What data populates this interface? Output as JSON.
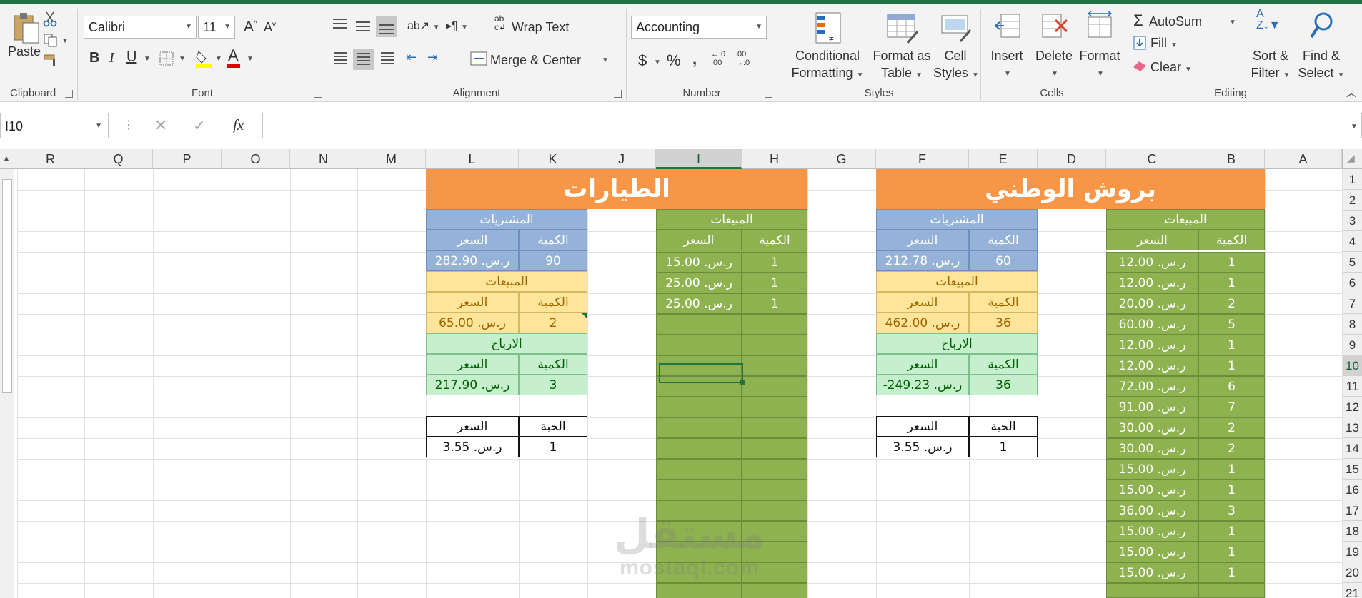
{
  "ribbon": {
    "clipboard": {
      "label": "Clipboard",
      "paste": "Paste"
    },
    "font": {
      "label": "Font",
      "font_name": "Calibri",
      "font_size": "11"
    },
    "alignment": {
      "label": "Alignment",
      "wrap_text": "Wrap Text",
      "merge_center": "Merge & Center"
    },
    "number": {
      "label": "Number",
      "format": "Accounting"
    },
    "styles": {
      "label": "Styles",
      "conditional": [
        "Conditional",
        "Formatting"
      ],
      "format_table": [
        "Format as",
        "Table"
      ],
      "cell_styles": [
        "Cell",
        "Styles"
      ]
    },
    "cells": {
      "label": "Cells",
      "insert": "Insert",
      "delete": "Delete",
      "format": "Format"
    },
    "editing": {
      "label": "Editing",
      "autosum": "AutoSum",
      "fill": "Fill",
      "clear": "Clear",
      "sort": [
        "Sort &",
        "Filter"
      ],
      "find": [
        "Find &",
        "Select"
      ]
    }
  },
  "formula_bar": {
    "name_box": "I10",
    "fx": "fx",
    "formula": ""
  },
  "columns": [
    "R",
    "Q",
    "P",
    "O",
    "N",
    "M",
    "L",
    "K",
    "J",
    "I",
    "H",
    "G",
    "F",
    "E",
    "D",
    "C",
    "B",
    "A"
  ],
  "rows": [
    "1",
    "2",
    "3",
    "4",
    "5",
    "6",
    "7",
    "8",
    "9",
    "10",
    "11",
    "12",
    "13",
    "14",
    "15",
    "16",
    "17",
    "18",
    "19",
    "20",
    "21"
  ],
  "selected_cell": "I10",
  "sheet": {
    "right_title": "بروش الوطني",
    "left_title": "الطيارات",
    "sales_header": "المبيعات",
    "purchases_header": "المشتريات",
    "profits_header": "الارباح",
    "qty_header": "الكمية",
    "price_header": "السعر",
    "unit_header": "الحبة",
    "right_sales": [
      {
        "qty": "1",
        "price": "ر.س. 12.00"
      },
      {
        "qty": "1",
        "price": "ر.س. 12.00"
      },
      {
        "qty": "2",
        "price": "ر.س. 20.00"
      },
      {
        "qty": "5",
        "price": "ر.س. 60.00"
      },
      {
        "qty": "1",
        "price": "ر.س. 12.00"
      },
      {
        "qty": "1",
        "price": "ر.س. 12.00"
      },
      {
        "qty": "6",
        "price": "ر.س. 72.00"
      },
      {
        "qty": "7",
        "price": "ر.س. 91.00"
      },
      {
        "qty": "2",
        "price": "ر.س. 30.00"
      },
      {
        "qty": "2",
        "price": "ر.س. 30.00"
      },
      {
        "qty": "1",
        "price": "ر.س. 15.00"
      },
      {
        "qty": "1",
        "price": "ر.س. 15.00"
      },
      {
        "qty": "3",
        "price": "ر.س. 36.00"
      },
      {
        "qty": "1",
        "price": "ر.س. 15.00"
      },
      {
        "qty": "1",
        "price": "ر.س. 15.00"
      },
      {
        "qty": "1",
        "price": "ر.س. 15.00"
      }
    ],
    "right_summary": {
      "purchases": {
        "qty": "60",
        "price": "ر.س. 212.78"
      },
      "sales": {
        "qty": "36",
        "price": "ر.س. 462.00"
      },
      "profits": {
        "qty": "36",
        "price": "-249.23 .ر.س"
      },
      "unit": {
        "qty": "1",
        "price": "ر.س. 3.55"
      }
    },
    "left_sales": [
      {
        "qty": "1",
        "price": "ر.س. 15.00"
      },
      {
        "qty": "1",
        "price": "ر.س. 25.00"
      },
      {
        "qty": "1",
        "price": "ر.س. 25.00"
      }
    ],
    "left_summary": {
      "purchases": {
        "qty": "90",
        "price": "ر.س. 282.90"
      },
      "sales": {
        "qty": "2",
        "price": "ر.س. 65.00"
      },
      "profits": {
        "qty": "3",
        "price": "ر.س. 217.90"
      },
      "unit": {
        "qty": "1",
        "price": "ر.س. 3.55"
      }
    }
  },
  "watermark": {
    "arabic": "مستقل",
    "latin": "mostaql.com"
  },
  "colors": {
    "excel_green": "#217346",
    "sales_green": "#8fb250",
    "purchase_blue": "#95b3d9",
    "sales_yellow": "#ffe599",
    "profit_green": "#c6efce",
    "title_orange": "#f79646"
  }
}
